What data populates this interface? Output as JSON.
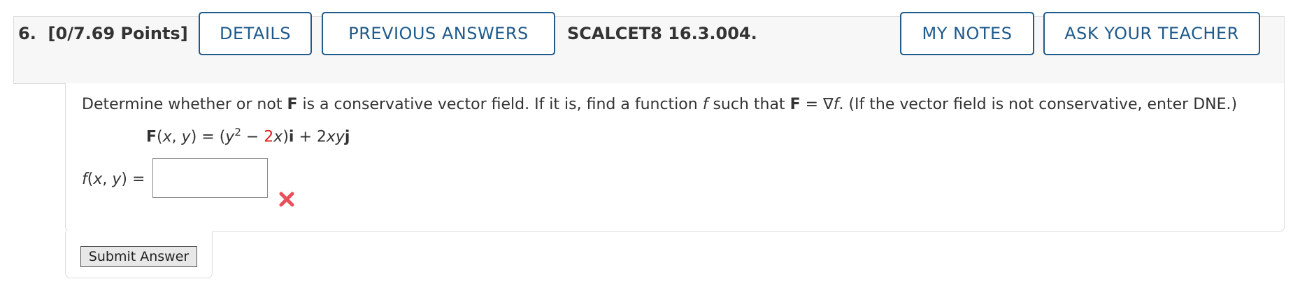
{
  "header": {
    "question_number": "6.",
    "points": "[0/7.69 Points]",
    "details_label": "DETAILS",
    "previous_answers_label": "PREVIOUS ANSWERS",
    "problem_code": "SCALCET8 16.3.004.",
    "my_notes_label": "MY NOTES",
    "ask_teacher_label": "ASK YOUR TEACHER",
    "button_color": "#1f5a8b"
  },
  "question": {
    "p1": "Determine whether or not ",
    "F_bold": "F",
    "p2": " is a conservative vector field. If it is, find a function ",
    "f_italic": "f",
    "p3": " such that ",
    "F_bold2": "F",
    "p4": " = ∇",
    "f_italic2": "f",
    "p5": ". (If the vector field is not conservative, enter DNE.)",
    "formula": {
      "F": "F",
      "args_open": "(",
      "x": "x",
      "comma": ", ",
      "y": "y",
      "args_close": ") = (",
      "y2": "y",
      "exp": "2",
      "minus": " − ",
      "coef": "2",
      "x2": "x",
      "close": ")",
      "i": "i",
      "plus": " + 2",
      "xy": "xy",
      "j": "j",
      "highlight_color": "#e0201b"
    }
  },
  "answer": {
    "label_f": "f",
    "label_args_open": "(",
    "label_x": "x",
    "label_comma": ", ",
    "label_y": "y",
    "label_tail": ") =",
    "value": "",
    "status_icon": "incorrect-x-icon",
    "status_color": "#e8505b"
  },
  "submit": {
    "label": "Submit Answer"
  }
}
